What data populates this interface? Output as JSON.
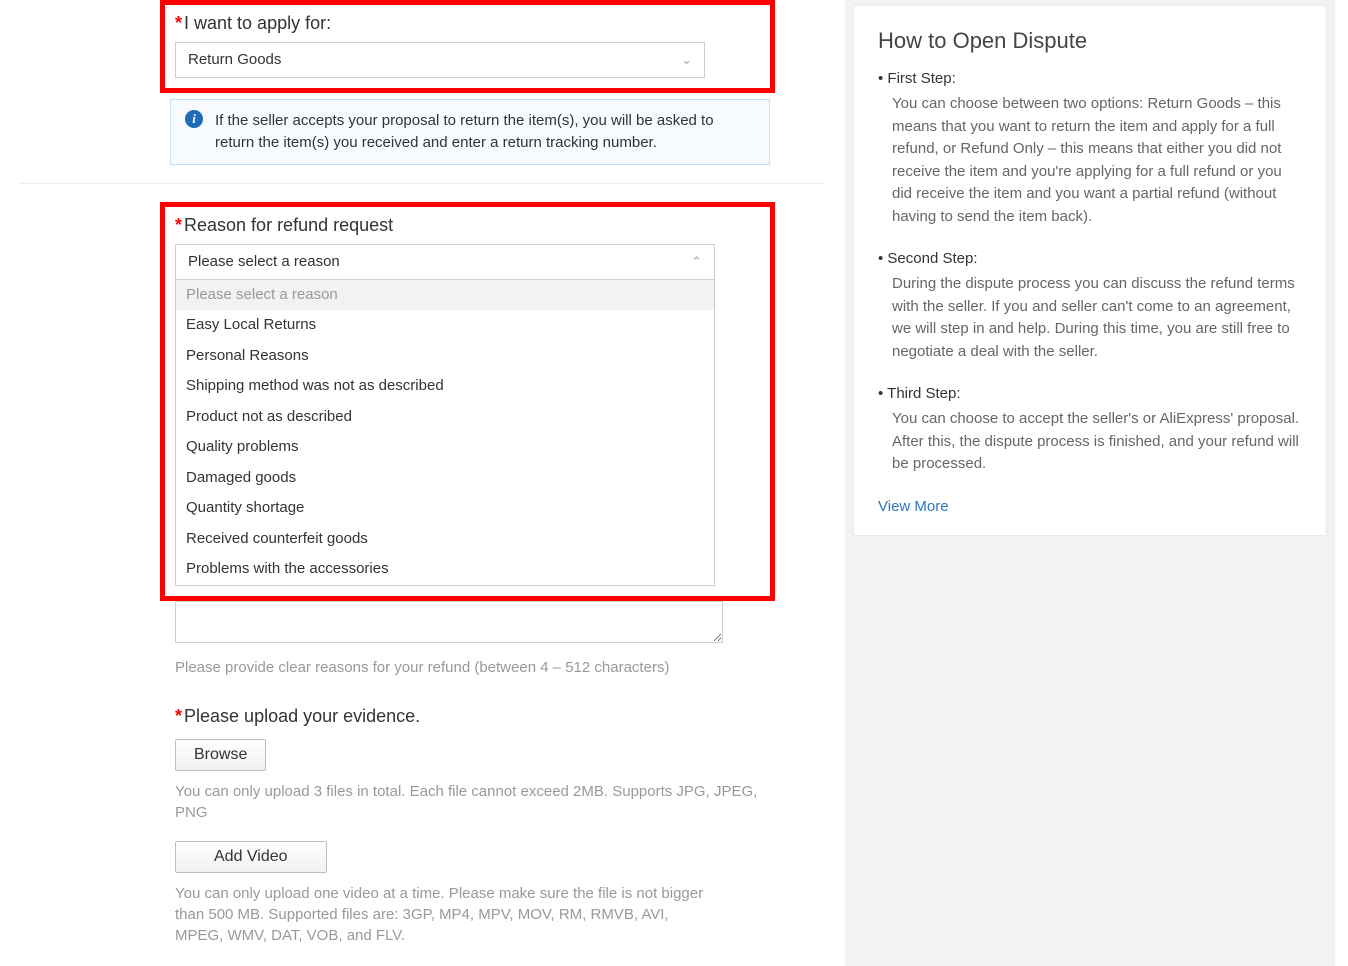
{
  "apply": {
    "label": "I want to apply for:",
    "selected": "Return Goods"
  },
  "info_note": "If the seller accepts your proposal to return the item(s), you will be asked to return the item(s) you received and enter a return tracking number.",
  "reason": {
    "label": "Reason for refund request",
    "selected": "Please select a reason",
    "placeholder_option": "Please select a reason",
    "options": [
      "Easy Local Returns",
      "Personal Reasons",
      "Shipping method was not as described",
      "Product not as described",
      "Quality problems",
      "Damaged goods",
      "Quantity shortage",
      "Received counterfeit goods",
      "Problems with the accessories"
    ]
  },
  "reason_help": "Please provide clear reasons for your refund (between 4 – 512 characters)",
  "evidence": {
    "label": "Please upload your evidence.",
    "browse_label": "Browse",
    "browse_help": "You can only upload 3 files in total. Each file cannot exceed 2MB. Supports JPG, JPEG, PNG",
    "video_label": "Add Video",
    "video_help": "You can only upload one video at a time. Please make sure the file is not bigger than 500 MB. Supported files are: 3GP, MP4, MPV, MOV, RM, RMVB, AVI, MPEG, WMV, DAT, VOB, and FLV."
  },
  "side": {
    "title": "How to Open Dispute",
    "steps": [
      {
        "label": "First Step:",
        "text": "You can choose between two options: Return Goods – this means that you want to return the item and apply for a full refund, or Refund Only – this means that either you did not receive the item and you're applying for a full refund or you did receive the item and you want a partial refund (without having to send the item back)."
      },
      {
        "label": "Second Step:",
        "text": "During the dispute process you can discuss the refund terms with the seller. If you and seller can't come to an agreement, we will step in and help. During this time, you are still free to negotiate a deal with the seller."
      },
      {
        "label": "Third Step:",
        "text": "You can choose to accept the seller's or AliExpress' proposal. After this, the dispute process is finished, and your refund will be processed."
      }
    ],
    "view_more": "View More"
  }
}
